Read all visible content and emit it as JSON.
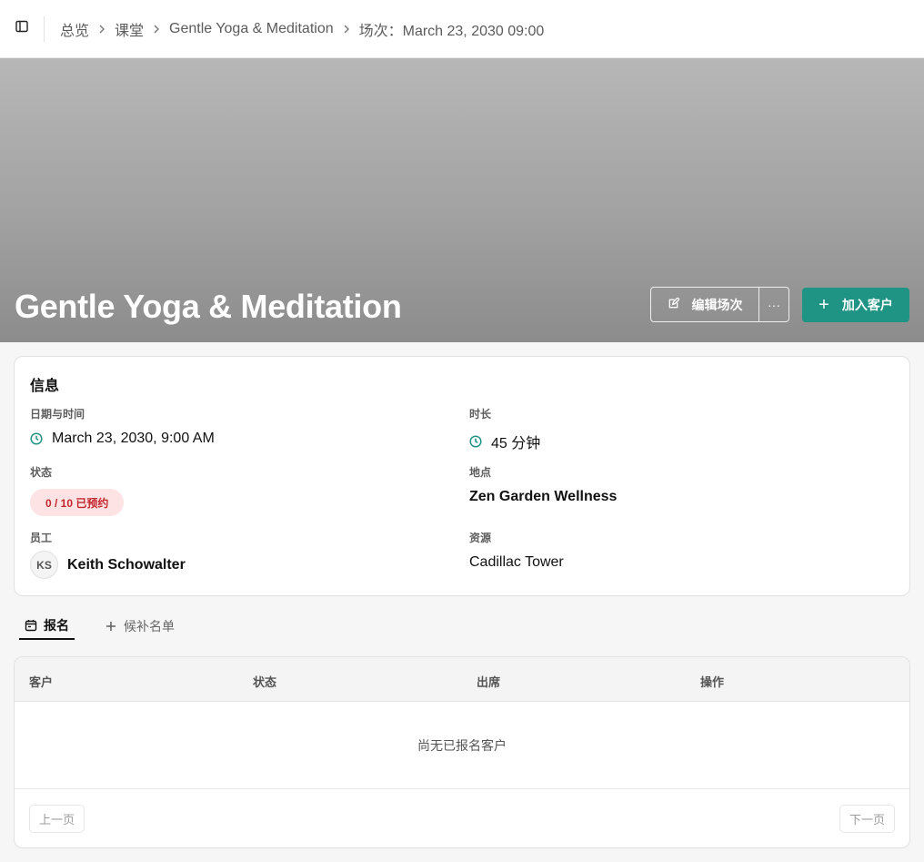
{
  "breadcrumb": {
    "items": [
      "总览",
      "课堂",
      "Gentle Yoga & Meditation",
      "场次：March 23, 2030 09:00"
    ]
  },
  "hero": {
    "title": "Gentle Yoga & Meditation",
    "edit_label": "编辑场次",
    "more_label": "···",
    "add_label": "加入客户"
  },
  "info": {
    "title": "信息",
    "datetime_label": "日期与时间",
    "datetime_value": "March 23, 2030, 9:00 AM",
    "duration_label": "时长",
    "duration_value": "45 分钟",
    "status_label": "状态",
    "status_value": "0 / 10 已预约",
    "location_label": "地点",
    "location_value": "Zen Garden Wellness",
    "staff_label": "员工",
    "staff_initials": "KS",
    "staff_name": "Keith Schowalter",
    "resource_label": "资源",
    "resource_value": "Cadillac Tower"
  },
  "tabs": {
    "enrollments": "报名",
    "waitlist": "候补名单"
  },
  "table": {
    "columns": [
      "客户",
      "状态",
      "出席",
      "操作"
    ],
    "empty_text": "尚无已报名客户",
    "prev_label": "上一页",
    "next_label": "下一页"
  },
  "colors": {
    "accent": "#1f9484",
    "status_bg": "#fde3e3",
    "status_text": "#c4262e"
  }
}
